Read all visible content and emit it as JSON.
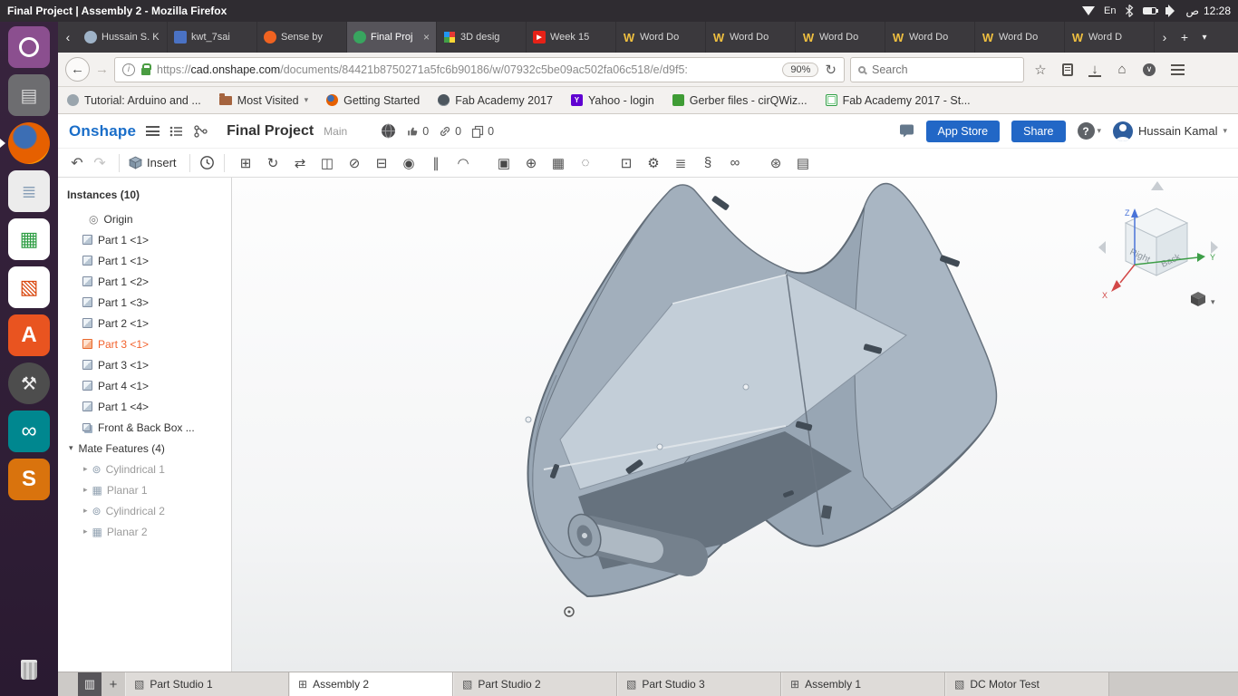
{
  "icons": {
    "tab_scroll_left": "‹",
    "tab_overflow": "›",
    "new_tab": "+",
    "tab_list": "▾",
    "back": "←",
    "forward": "→",
    "reload": "↻",
    "star": "☆",
    "home": "⌂",
    "undo": "↶",
    "redo": "↷",
    "dropdown": "▾",
    "chevron_right": "▸",
    "origin": "◎",
    "mate_cylindrical": "⊚",
    "mate_planar": "▦",
    "partstudio_tab": "▧",
    "assembly_tab": "⊞",
    "panel_grid": "▥",
    "plus": "+",
    "close": "×",
    "pocket": "∨",
    "youtube_play": "▶"
  },
  "desktop": {
    "title_bar": {
      "title": "Final Project | Assembly 2 - Mozilla Firefox",
      "keyboard_lang": "En",
      "clock_meridiem": "ص",
      "clock_time": "12:28"
    },
    "launcher": {
      "software_glyph": "A",
      "files_glyph": "▤",
      "editor_glyph": "≣",
      "calc_glyph": "▦",
      "impress_glyph": "▧",
      "tools_glyph": "⚒",
      "arduino_glyph": "∞",
      "sublime_glyph": "S"
    }
  },
  "firefox": {
    "tabs": [
      {
        "label": "Hussain S. K"
      },
      {
        "label": "kwt_7sai"
      },
      {
        "label": "Sense by"
      },
      {
        "label": "Final Proj",
        "close": "×"
      },
      {
        "label": "3D desig"
      },
      {
        "label": "Week 15",
        "fav_glyph": "▶"
      },
      {
        "label": "Word Do",
        "fav_glyph": "W"
      },
      {
        "label": "Word Do",
        "fav_glyph": "W"
      },
      {
        "label": "Word Do",
        "fav_glyph": "W"
      },
      {
        "label": "Word Do",
        "fav_glyph": "W"
      },
      {
        "label": "Word Do",
        "fav_glyph": "W"
      },
      {
        "label": "Word D",
        "fav_glyph": "W"
      }
    ],
    "nav": {
      "url_scheme": "https://",
      "url_domain": "cad.onshape.com",
      "url_path": "/documents/84421b8750271a5fc6b90186/w/07932c5be09ac502fa06c518/e/d9f5:",
      "zoom_badge": "90%",
      "search_placeholder": "Search"
    },
    "bookmarks": [
      {
        "label": "Tutorial: Arduino and ..."
      },
      {
        "label": "Most Visited"
      },
      {
        "label": "Getting Started"
      },
      {
        "label": "Fab Academy 2017"
      },
      {
        "label": "Yahoo - login",
        "fav_glyph": "Y"
      },
      {
        "label": "Gerber files - cirQWiz..."
      },
      {
        "label": "Fab Academy 2017 - St..."
      }
    ]
  },
  "onshape": {
    "header": {
      "logo": "Onshape",
      "doc_title": "Final Project",
      "workspace": "Main",
      "like_count": "0",
      "link_count": "0",
      "copy_count": "0",
      "app_store_label": "App Store",
      "share_label": "Share",
      "help_label": "?",
      "user_name": "Hussain Kamal"
    },
    "toolbar": {
      "insert_label": "Insert",
      "icons": [
        {
          "name": "fastened-mate",
          "glyph": "⊞"
        },
        {
          "name": "revolute-mate",
          "glyph": "↻"
        },
        {
          "name": "slider-mate",
          "glyph": "⇄"
        },
        {
          "name": "planar-mate",
          "glyph": "◫"
        },
        {
          "name": "cylindrical-mate",
          "glyph": "⊘"
        },
        {
          "name": "pin-slot-mate",
          "glyph": "⊟"
        },
        {
          "name": "ball-mate",
          "glyph": "◉"
        },
        {
          "name": "parallel-mate",
          "glyph": "∥"
        },
        {
          "name": "tangent-mate",
          "glyph": "◠"
        },
        {
          "name": "group",
          "glyph": "▣"
        },
        {
          "name": "mate-connector",
          "glyph": "⊕"
        },
        {
          "name": "linear-pattern",
          "glyph": "▦"
        },
        {
          "name": "circular-pattern",
          "glyph": "◌"
        },
        {
          "name": "replicate",
          "glyph": "⊡"
        },
        {
          "name": "gear-relation",
          "glyph": "⚙"
        },
        {
          "name": "rack-pinion-relation",
          "glyph": "≣"
        },
        {
          "name": "screw-relation",
          "glyph": "§"
        },
        {
          "name": "belt-relation",
          "glyph": "∞"
        },
        {
          "name": "exploded-view",
          "glyph": "⊛"
        },
        {
          "name": "bom-table",
          "glyph": "▤"
        }
      ]
    },
    "instances_panel": {
      "header": "Instances (10)",
      "origin_label": "Origin",
      "parts": [
        {
          "label": "Part 1 <1>"
        },
        {
          "label": "Part 1 <1>"
        },
        {
          "label": "Part 1 <2>"
        },
        {
          "label": "Part 1 <3>"
        },
        {
          "label": "Part 2 <1>"
        },
        {
          "label": "Part 3 <1>"
        },
        {
          "label": "Part 3 <1>"
        },
        {
          "label": "Part 4 <1>"
        },
        {
          "label": "Part 1 <4>"
        },
        {
          "label": "Front & Back Box ..."
        }
      ],
      "mates_header": "Mate Features (4)",
      "mates": [
        {
          "label": "Cylindrical 1"
        },
        {
          "label": "Planar 1"
        },
        {
          "label": "Cylindrical 2"
        },
        {
          "label": "Planar 2"
        }
      ]
    },
    "view_cube": {
      "left_face": "Right",
      "right_face": "Back",
      "axis_x": "X",
      "axis_y": "Y",
      "axis_z": "Z"
    },
    "bottom_tabs": [
      {
        "label": "Part Studio 1"
      },
      {
        "label": "Assembly 2"
      },
      {
        "label": "Part Studio 2"
      },
      {
        "label": "Part Studio 3"
      },
      {
        "label": "Assembly 1"
      },
      {
        "label": "DC Motor Test"
      }
    ]
  }
}
